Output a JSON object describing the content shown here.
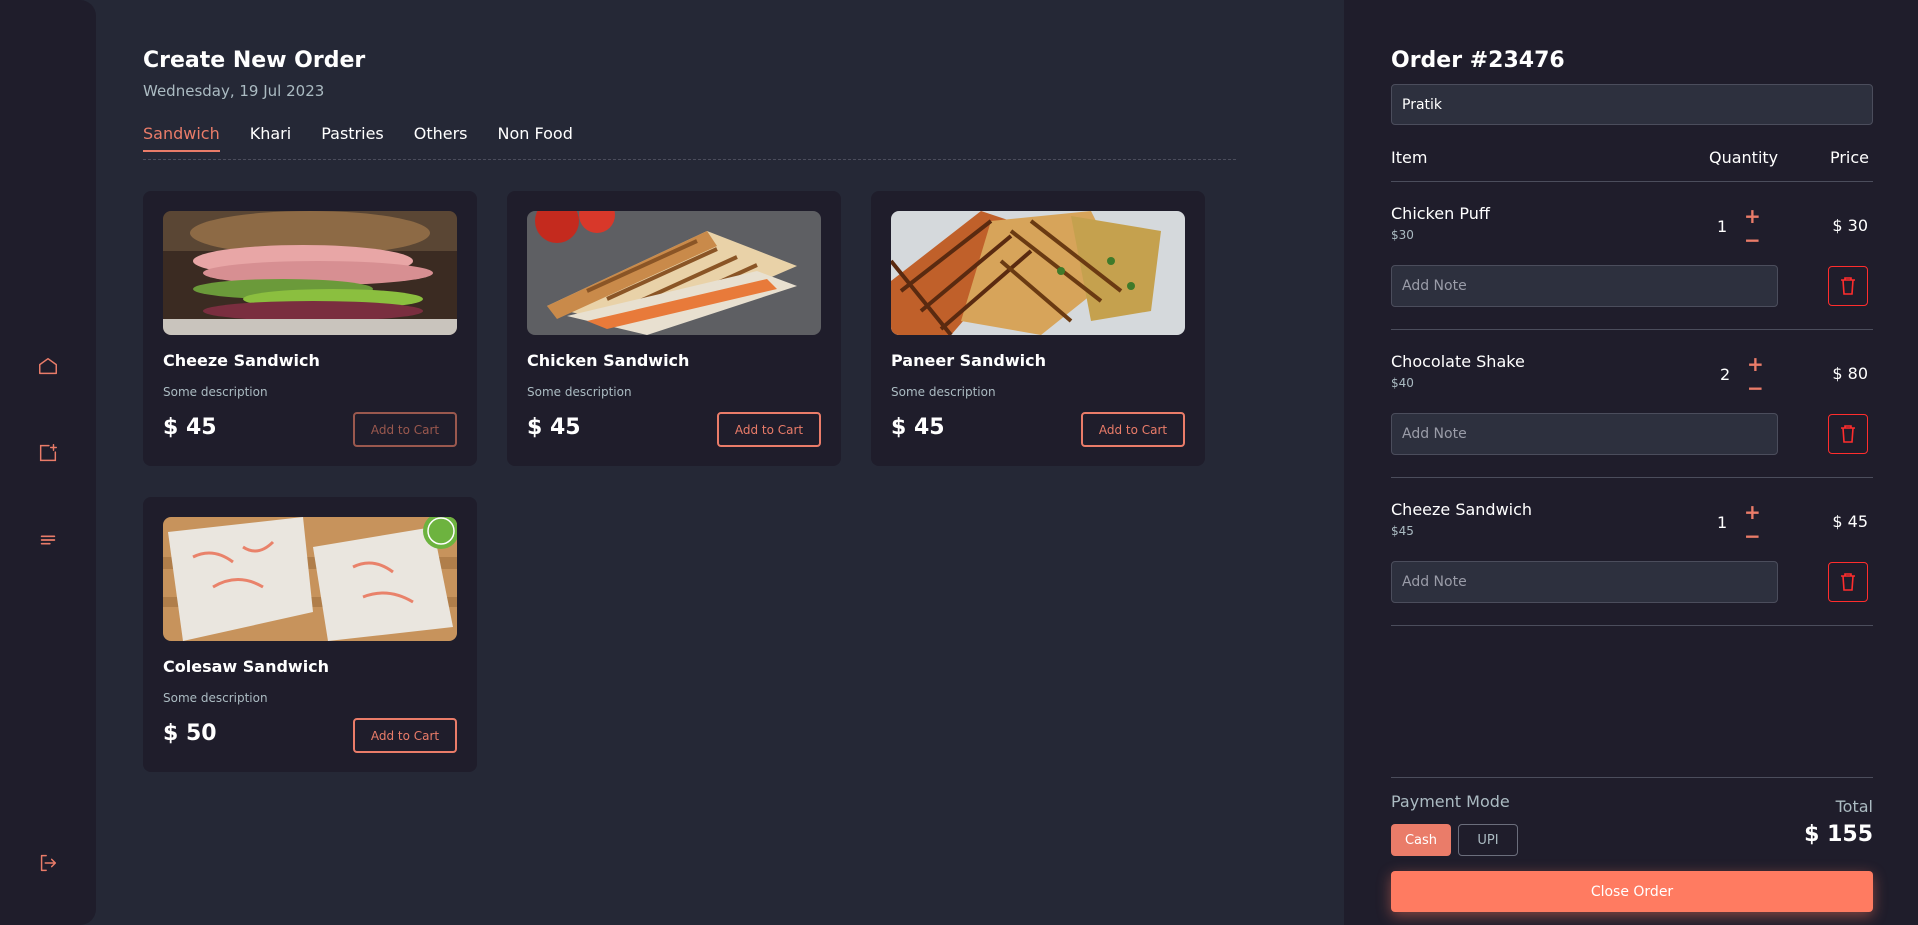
{
  "colors": {
    "accent": "#ea7c69",
    "delete": "#ff2d2d",
    "panel_bg": "#1f1d2b",
    "page_bg": "#252836"
  },
  "sidebar": {
    "items": [
      {
        "icon": "home-icon"
      },
      {
        "icon": "new-order-icon"
      },
      {
        "icon": "menu-lines-icon"
      },
      {
        "icon": "logout-icon"
      }
    ]
  },
  "header": {
    "title": "Create New Order",
    "date": "Wednesday, 19 Jul 2023"
  },
  "tabs": [
    {
      "label": "Sandwich",
      "active": true
    },
    {
      "label": "Khari"
    },
    {
      "label": "Pastries"
    },
    {
      "label": "Others"
    },
    {
      "label": "Non Food"
    }
  ],
  "products": [
    {
      "name": "Cheeze Sandwich",
      "description": "Some description",
      "price": "$ 45",
      "button": "Add to Cart",
      "image": "cheese-sandwich-photo"
    },
    {
      "name": "Chicken Sandwich",
      "description": "Some description",
      "price": "$ 45",
      "button": "Add to Cart",
      "image": "chicken-sandwich-photo"
    },
    {
      "name": "Paneer Sandwich",
      "description": "Some description",
      "price": "$ 45",
      "button": "Add to Cart",
      "image": "paneer-sandwich-photo"
    },
    {
      "name": "Colesaw Sandwich",
      "description": "Some description",
      "price": "$ 50",
      "button": "Add to Cart",
      "image": "coleslaw-sandwich-photo"
    }
  ],
  "order": {
    "title": "Order #23476",
    "customer_name": "Pratik",
    "columns": {
      "item": "Item",
      "quantity": "Quantity",
      "price": "Price"
    },
    "items": [
      {
        "name": "Chicken Puff",
        "unit_price": "$30",
        "quantity": "1",
        "price": "$ 30",
        "note_placeholder": "Add Note"
      },
      {
        "name": "Chocolate Shake",
        "unit_price": "$40",
        "quantity": "2",
        "price": "$ 80",
        "note_placeholder": "Add Note"
      },
      {
        "name": "Cheeze Sandwich",
        "unit_price": "$45",
        "quantity": "1",
        "price": "$ 45",
        "note_placeholder": "Add Note"
      }
    ],
    "qty_plus": "+",
    "qty_minus": "−",
    "payment_label": "Payment Mode",
    "payment_modes": [
      {
        "label": "Cash",
        "active": true
      },
      {
        "label": "UPI",
        "active": false
      }
    ],
    "total_label": "Total",
    "total_value": "$ 155",
    "close_button": "Close Order"
  }
}
